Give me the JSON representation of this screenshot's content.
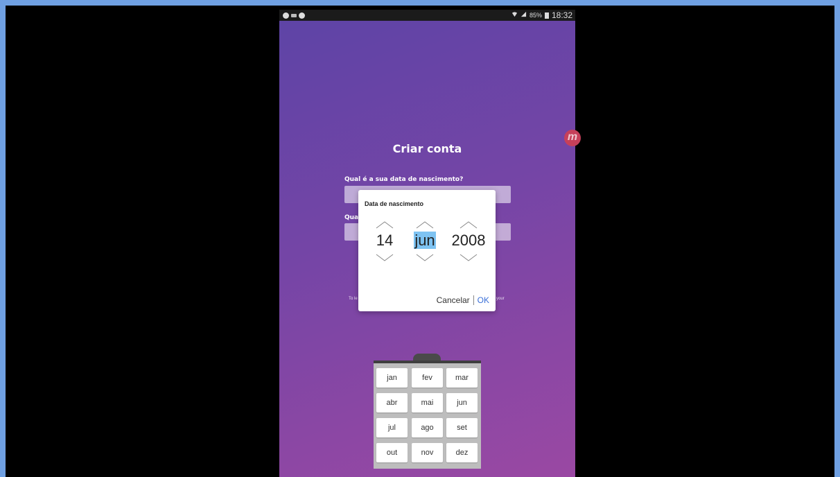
{
  "status_bar": {
    "battery": "85%",
    "time": "18:32"
  },
  "screen": {
    "title": "Criar conta",
    "birth_question": "Qual é a sua data de nascimento?",
    "second_question_prefix": "Qua",
    "terms_left": "To le",
    "terms_right": "your",
    "fab_label": "m"
  },
  "date_dialog": {
    "title": "Data de nascimento",
    "day": "14",
    "month": "jun",
    "year": "2008",
    "cancel_label": "Cancelar",
    "ok_label": "OK"
  },
  "month_keypad": {
    "rows": [
      [
        "jan",
        "fev",
        "mar"
      ],
      [
        "abr",
        "mai",
        "jun"
      ],
      [
        "jul",
        "ago",
        "set"
      ],
      [
        "out",
        "nov",
        "dez"
      ]
    ]
  }
}
